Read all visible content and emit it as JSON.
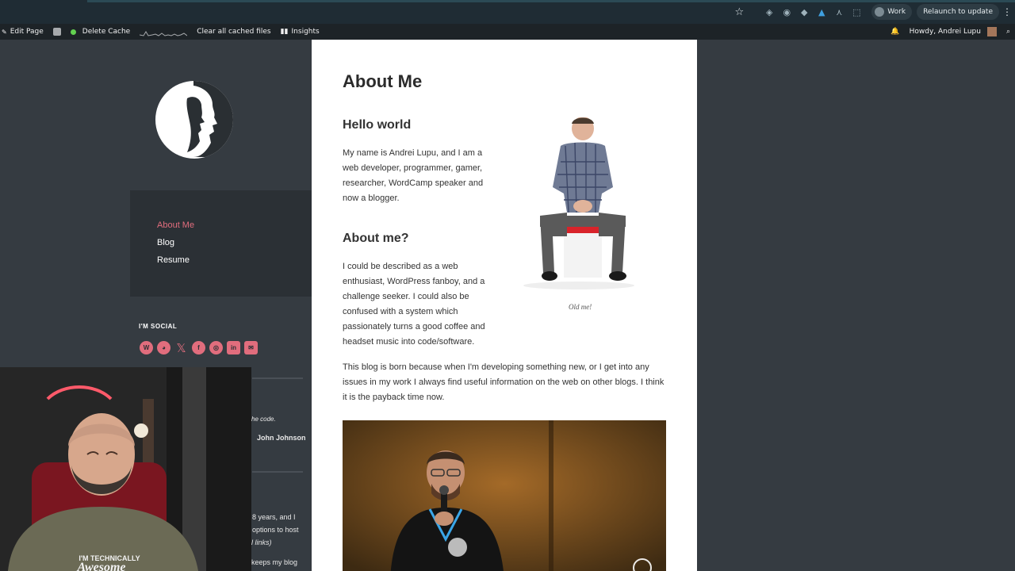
{
  "browser": {
    "profile_label": "Work",
    "relaunch_label": "Relaunch to update"
  },
  "adminbar": {
    "edit_page": "Edit Page",
    "delete_cache": "Delete Cache",
    "clear_cache": "Clear all cached files",
    "insights": "Insights",
    "howdy": "Howdy, Andrei Lupu"
  },
  "sidebar": {
    "menu": [
      {
        "label": "About Me"
      },
      {
        "label": "Blog"
      },
      {
        "label": "Resume"
      }
    ],
    "social_title": "I'M SOCIAL",
    "snippets": {
      "code": "he code.",
      "author": "John Johnson",
      "l1": "8 years, and I",
      "l2": "options to host",
      "l3": "l links)",
      "l4": "keeps my blog"
    }
  },
  "page": {
    "title": "About Me",
    "h_hello": "Hello world",
    "p_hello": "My name is Andrei Lupu, and I am a web developer, programmer, gamer, researcher, WordCamp speaker and now a blogger.",
    "h_about": "About me?",
    "p_about": "I could be described as a web enthusiast, WordPress fanboy, and a challenge seeker. I could also be confused with a system which passionately turns a good coffee and headset music into code/software.",
    "p_blog": "This blog is born because when I'm developing something new, or I get into any issues in my work I always find useful information on the web on other blogs. I think it is the payback time now.",
    "caption": "Old me!"
  },
  "webcam": {
    "shirt_line1": "I'M TECHNICALLY",
    "shirt_line2": "Awesome"
  },
  "colors": {
    "accent": "#e16d7d",
    "page_bg": "#353b41",
    "adminbar": "#1d2327"
  }
}
